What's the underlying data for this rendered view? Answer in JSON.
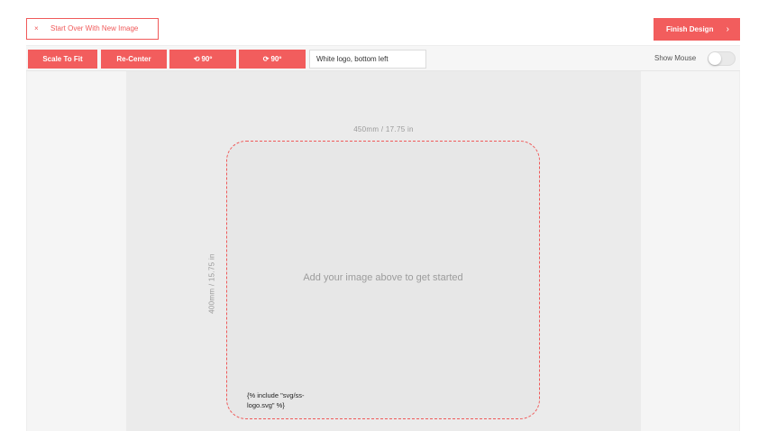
{
  "header": {
    "start_over": {
      "icon": "close-icon",
      "icon_glyph": "×",
      "label": "Start Over With New Image"
    },
    "finish": {
      "label": "Finish Design",
      "icon": "chevron-right-icon",
      "icon_glyph": "›"
    }
  },
  "toolbar": {
    "scale_to_fit": "Scale To Fit",
    "re_center": "Re-Center",
    "rotate_left": {
      "icon": "rotate-ccw-icon",
      "icon_glyph": "⟲",
      "label": "90º"
    },
    "rotate_right": {
      "icon": "rotate-cw-icon",
      "icon_glyph": "⟳",
      "label": "90º"
    },
    "text_input_value": "White logo, bottom left",
    "show_mouse_label": "Show Mouse",
    "show_mouse_on": false
  },
  "canvas": {
    "width_label": "450mm / 17.75 in",
    "height_label": "400mm / 15.75 in",
    "prompt": "Add your image above to get started",
    "logo_placeholder": "{% include \"svg/ss-logo.svg\" %}"
  },
  "colors": {
    "accent": "#f25d5d",
    "dashed_border": "#f05a5a",
    "canvas_bg": "#ebebeb",
    "workspace_bg": "#f5f5f5"
  }
}
